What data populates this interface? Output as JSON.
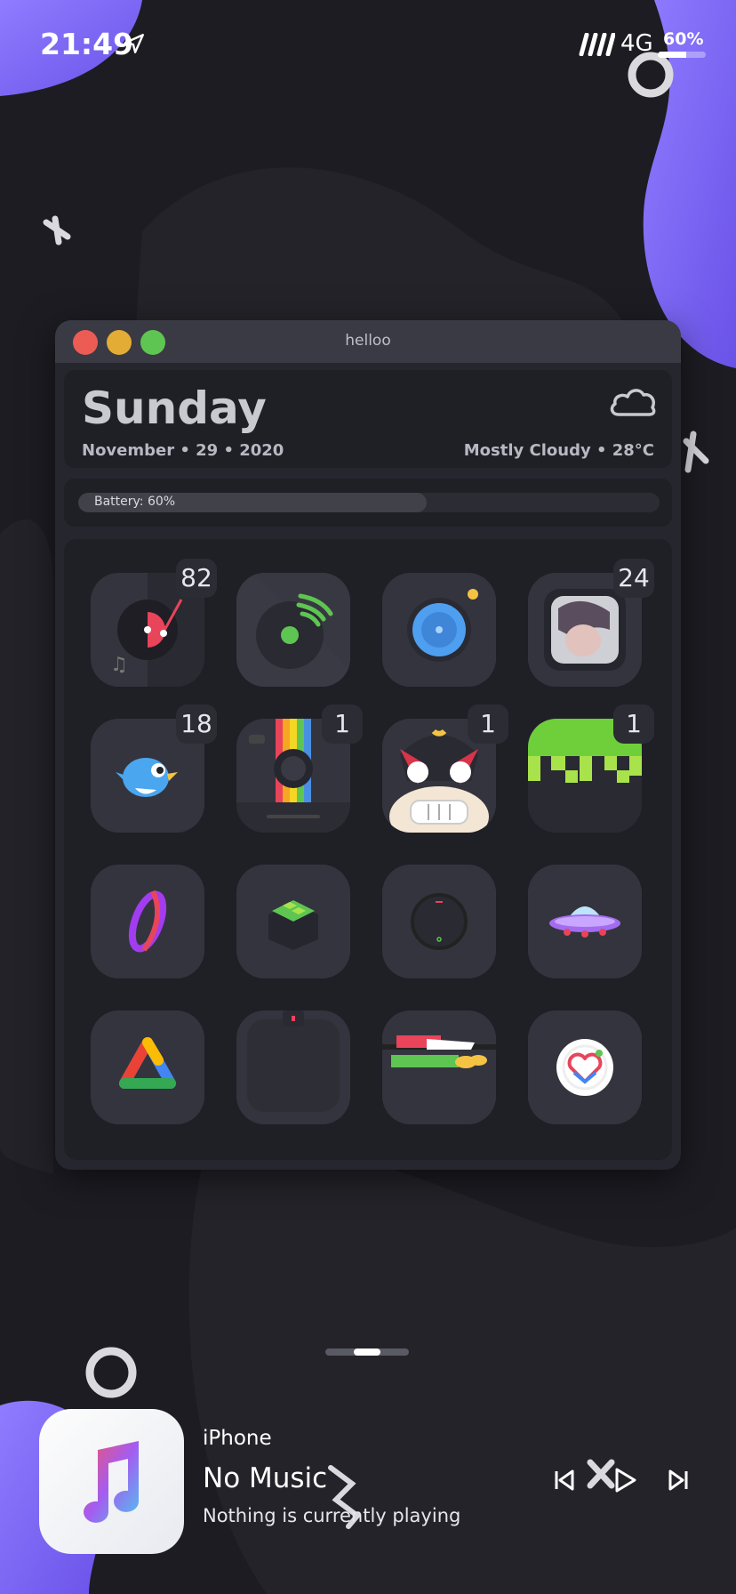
{
  "status_bar": {
    "time": "21:49",
    "network": "4G",
    "battery_percent_text": "60%",
    "battery_level": 0.6
  },
  "window": {
    "title": "helloo",
    "date_widget": {
      "day": "Sunday",
      "date": "November • 29 • 2020",
      "weather": "Mostly Cloudy • 28°C",
      "weather_icon": "cloud-icon"
    },
    "battery_widget": {
      "label": "Battery: 60%",
      "level": 0.6
    },
    "apps": [
      {
        "name": "music-app-icon",
        "badge": "82"
      },
      {
        "name": "spotify-app-icon",
        "badge": ""
      },
      {
        "name": "camera-app-icon",
        "badge": ""
      },
      {
        "name": "photos-app-icon",
        "badge": "24"
      },
      {
        "name": "tweetbot-app-icon",
        "badge": "18"
      },
      {
        "name": "instagram-app-icon",
        "badge": "1"
      },
      {
        "name": "luchador-app-icon",
        "badge": "1"
      },
      {
        "name": "minecraft-app-icon",
        "badge": "1"
      },
      {
        "name": "letter-o-app-icon",
        "badge": ""
      },
      {
        "name": "cydia-box-app-icon",
        "badge": ""
      },
      {
        "name": "clock-dial-app-icon",
        "badge": ""
      },
      {
        "name": "ufo-app-icon",
        "badge": ""
      },
      {
        "name": "google-workspace-app-icon",
        "badge": ""
      },
      {
        "name": "blank-box-app-icon",
        "badge": ""
      },
      {
        "name": "wallet-app-icon",
        "badge": ""
      },
      {
        "name": "health-watch-app-icon",
        "badge": ""
      }
    ]
  },
  "now_playing": {
    "source": "iPhone",
    "title": "No Music",
    "subtitle": "Nothing is currently playing",
    "artwork_icon": "music-note-icon"
  },
  "colors": {
    "background": "#1c1c22",
    "accent_purple": "#8b6cf0",
    "window_bg": "#26262e"
  }
}
